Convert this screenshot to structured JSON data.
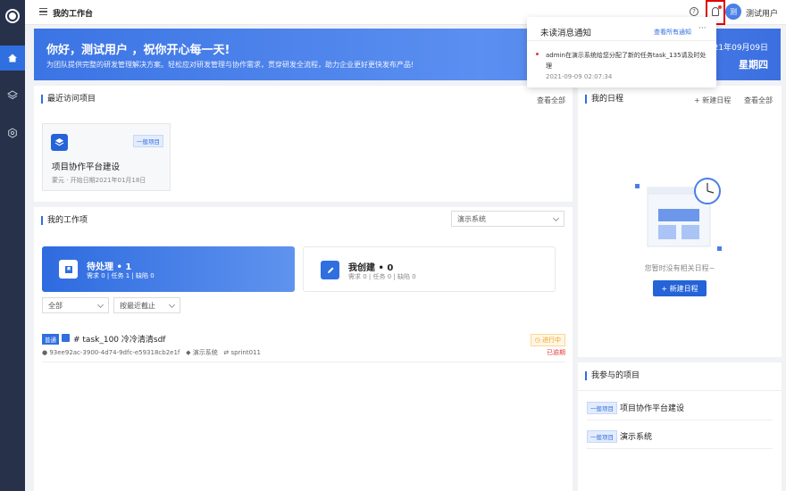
{
  "topbar": {
    "title": "我的工作台",
    "help_icon": "?",
    "avatar_text": "测",
    "username": "测试用户"
  },
  "banner": {
    "greeting": "你好，测试用户 ，祝你开心每一天!",
    "subtitle": "为团队提供完整的研发管理解决方案。轻松应对研发管理与协作需求，贯穿研发全流程，助力企业更好更快发布产品!",
    "date": "2021年09月09日",
    "weekday": "星期四"
  },
  "recent": {
    "title": "最近访问项目",
    "view_all": "查看全部",
    "project": {
      "tag": "一般项目",
      "name": "项目协作平台建设",
      "meta": "蒙元 · 开始日期2021年01月18日"
    }
  },
  "work": {
    "title": "我的工作项",
    "project_select": "演示系统",
    "todo": {
      "title": "待处理 • 1",
      "sub": "需求 0 | 任务 1 | 缺陷 0"
    },
    "created": {
      "title": "我创建 • 0",
      "sub": "需求 0 | 任务 0 | 缺陷 0"
    },
    "filter_all": "全部",
    "filter_sort": "按最近截止",
    "task": {
      "badge": "普通",
      "name": "# task_100 冷冷清清sdf",
      "status": "进行中",
      "meta_id": "93ee92ac-3900-4d74-9dfc-e59318cb2e1f",
      "meta_project": "演示系统",
      "meta_sprint": "sprint011",
      "overdue": "已逾期"
    }
  },
  "schedule": {
    "title": "我的日程",
    "new_link": "+ 新建日程",
    "view_all": "查看全部",
    "empty": "您暂时没有相关日程~",
    "new_button": "+ 新建日程"
  },
  "joined": {
    "title": "我参与的项目",
    "items": [
      {
        "tag": "一般项目",
        "name": "项目协作平台建设"
      },
      {
        "tag": "一般项目",
        "name": "演示系统"
      }
    ]
  },
  "notification": {
    "title": "未读消息通知",
    "view_all": "查看所有通知",
    "more": "···",
    "message": "admin在演示系统给您分配了新的任务task_135请及时处理",
    "time": "2021-09-09 02:07:34"
  },
  "colors": {
    "accent": "#2f6fe0",
    "sidebar": "#27314a",
    "highlight_border": "#e00000"
  }
}
